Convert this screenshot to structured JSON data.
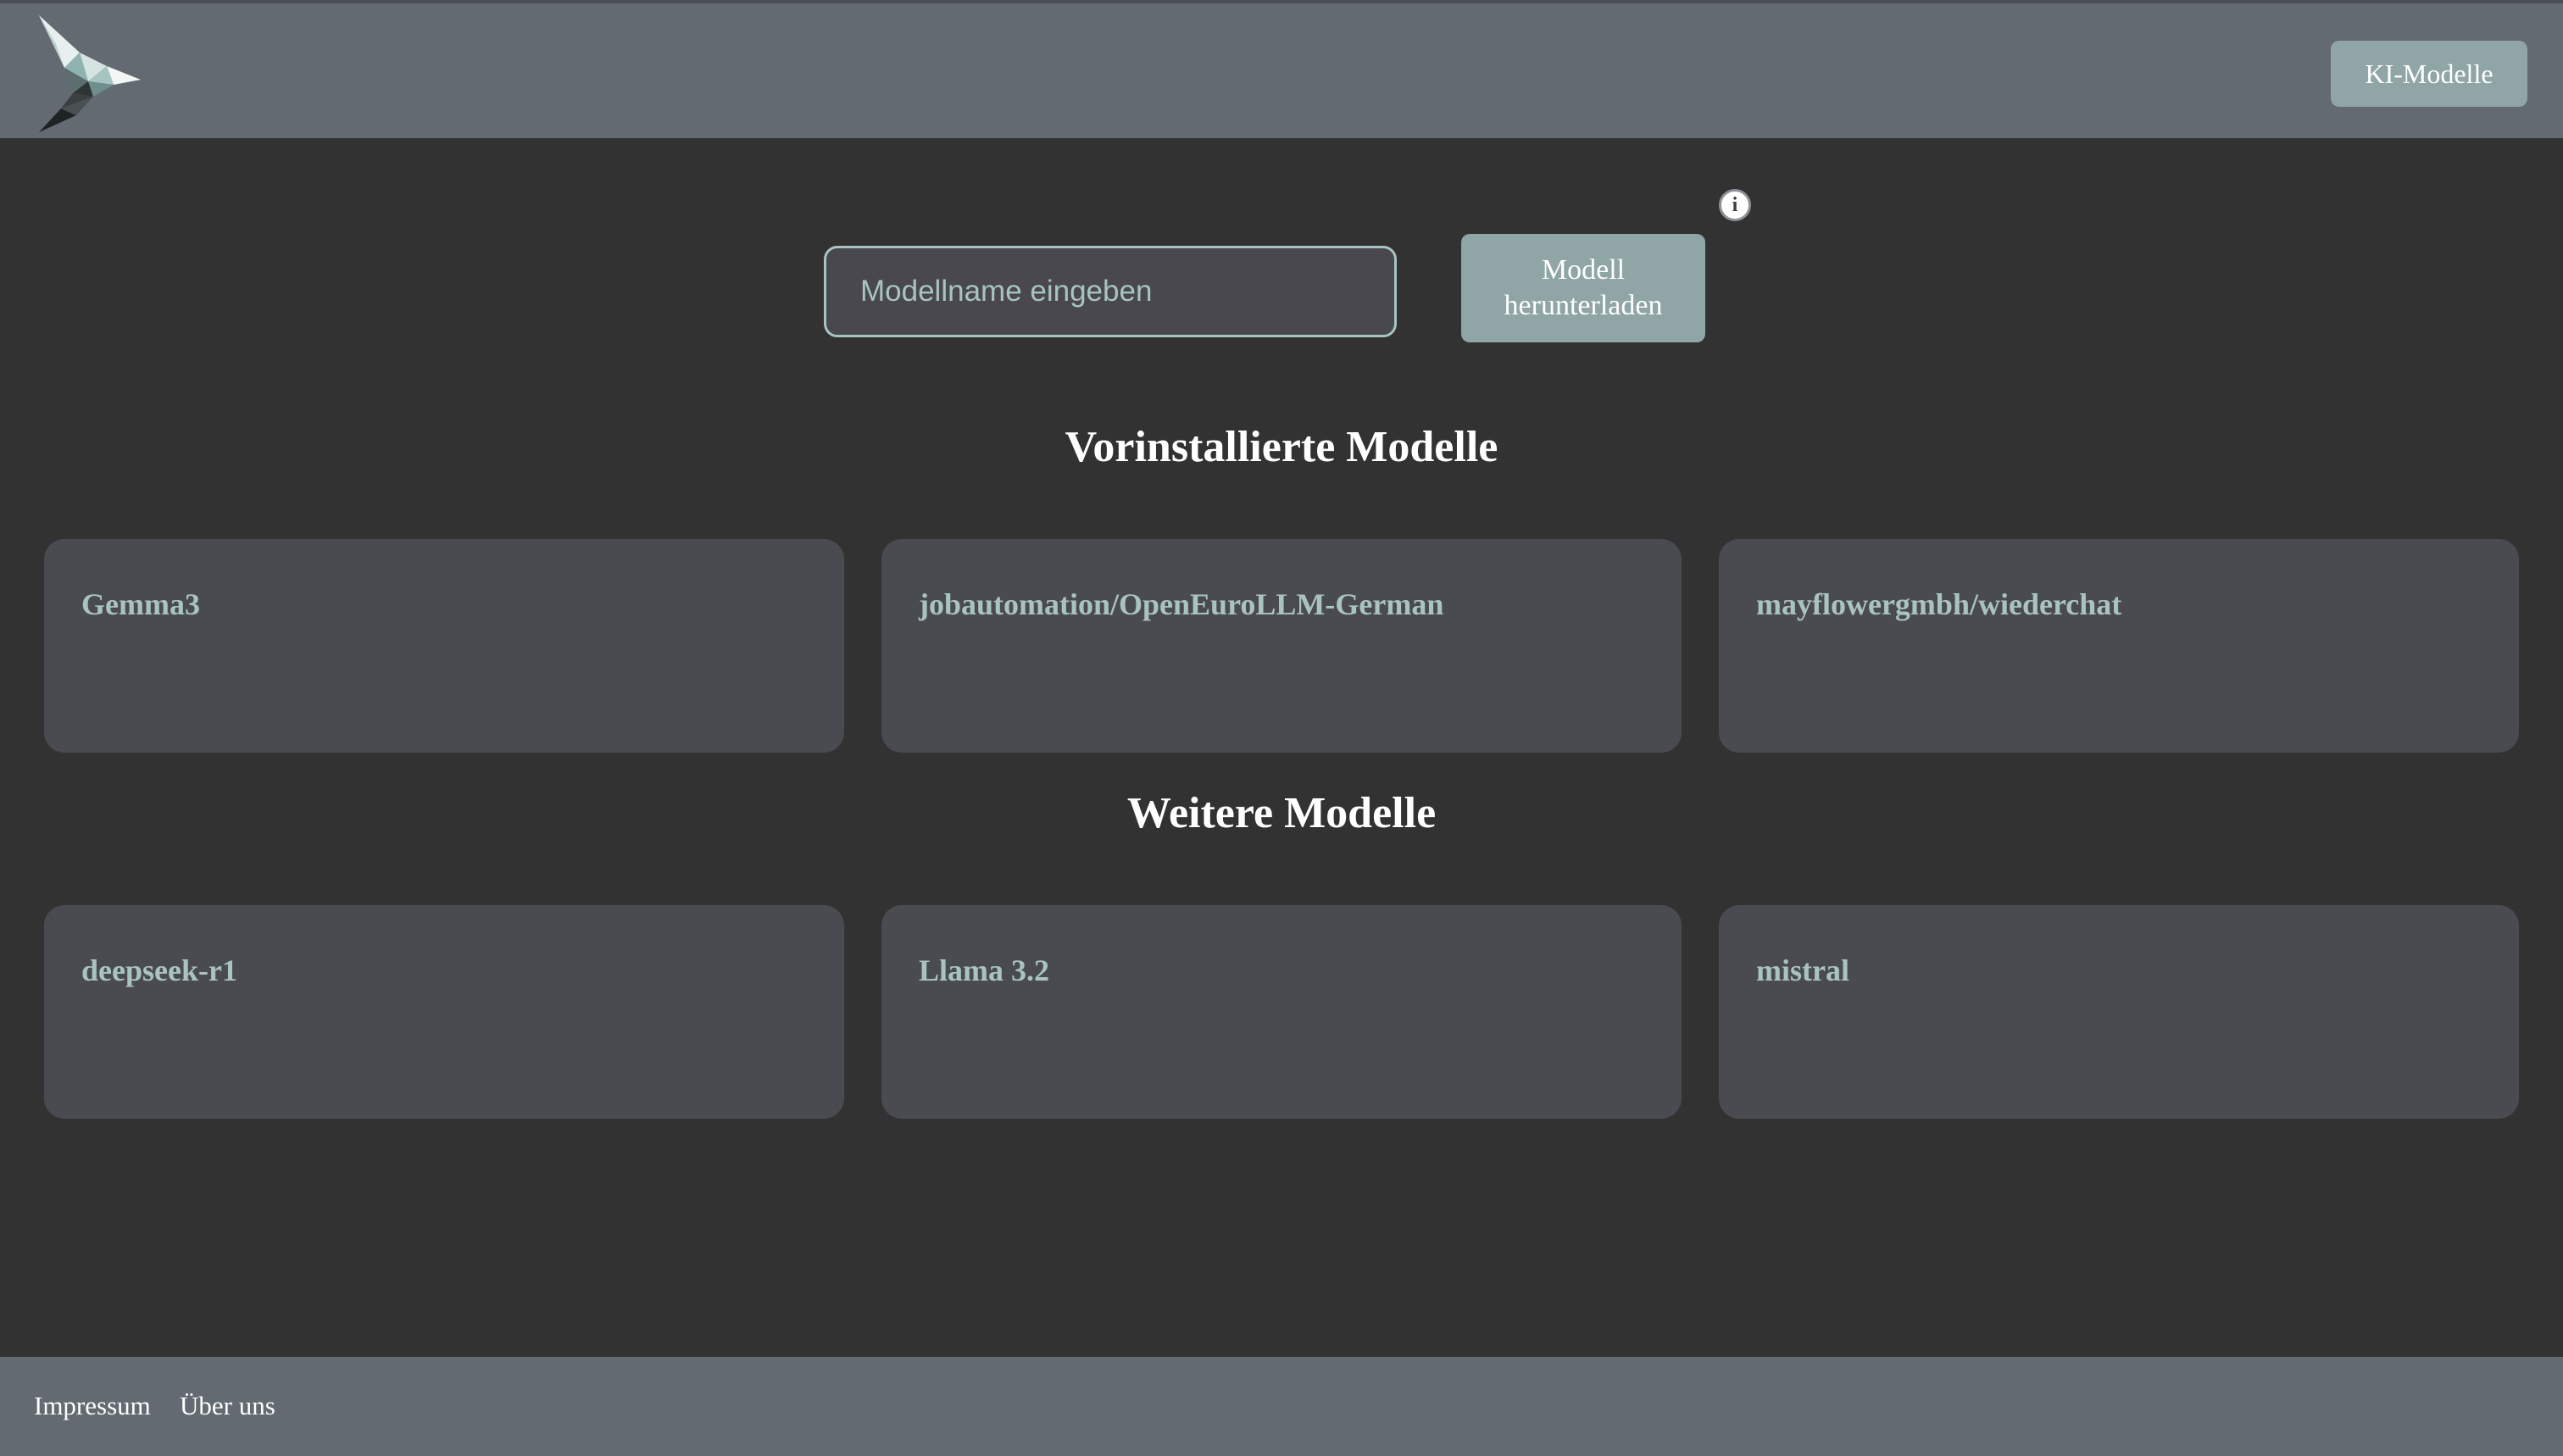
{
  "header": {
    "logo": "paper-plane-logo",
    "nav_button_label": "KI-Modelle"
  },
  "search": {
    "placeholder": "Modellname eingeben",
    "value": "",
    "download_line1": "Modell",
    "download_line2": "herunterladen",
    "info_glyph": "i"
  },
  "preinstalled": {
    "title": "Vorinstallierte Modelle",
    "models": [
      "Gemma3",
      "jobautomation/OpenEuroLLM-German",
      "mayflowergmbh/wiederchat"
    ]
  },
  "more": {
    "title": "Weitere Modelle",
    "models": [
      "deepseek-r1",
      "Llama 3.2",
      "mistral"
    ]
  },
  "footer": {
    "links": [
      "Impressum",
      "Über uns"
    ]
  },
  "colors": {
    "background": "#323232",
    "bar": "#636a71",
    "accent": "#8fa5a6",
    "card": "#4a4b51",
    "card_text": "#a9c3c1"
  }
}
